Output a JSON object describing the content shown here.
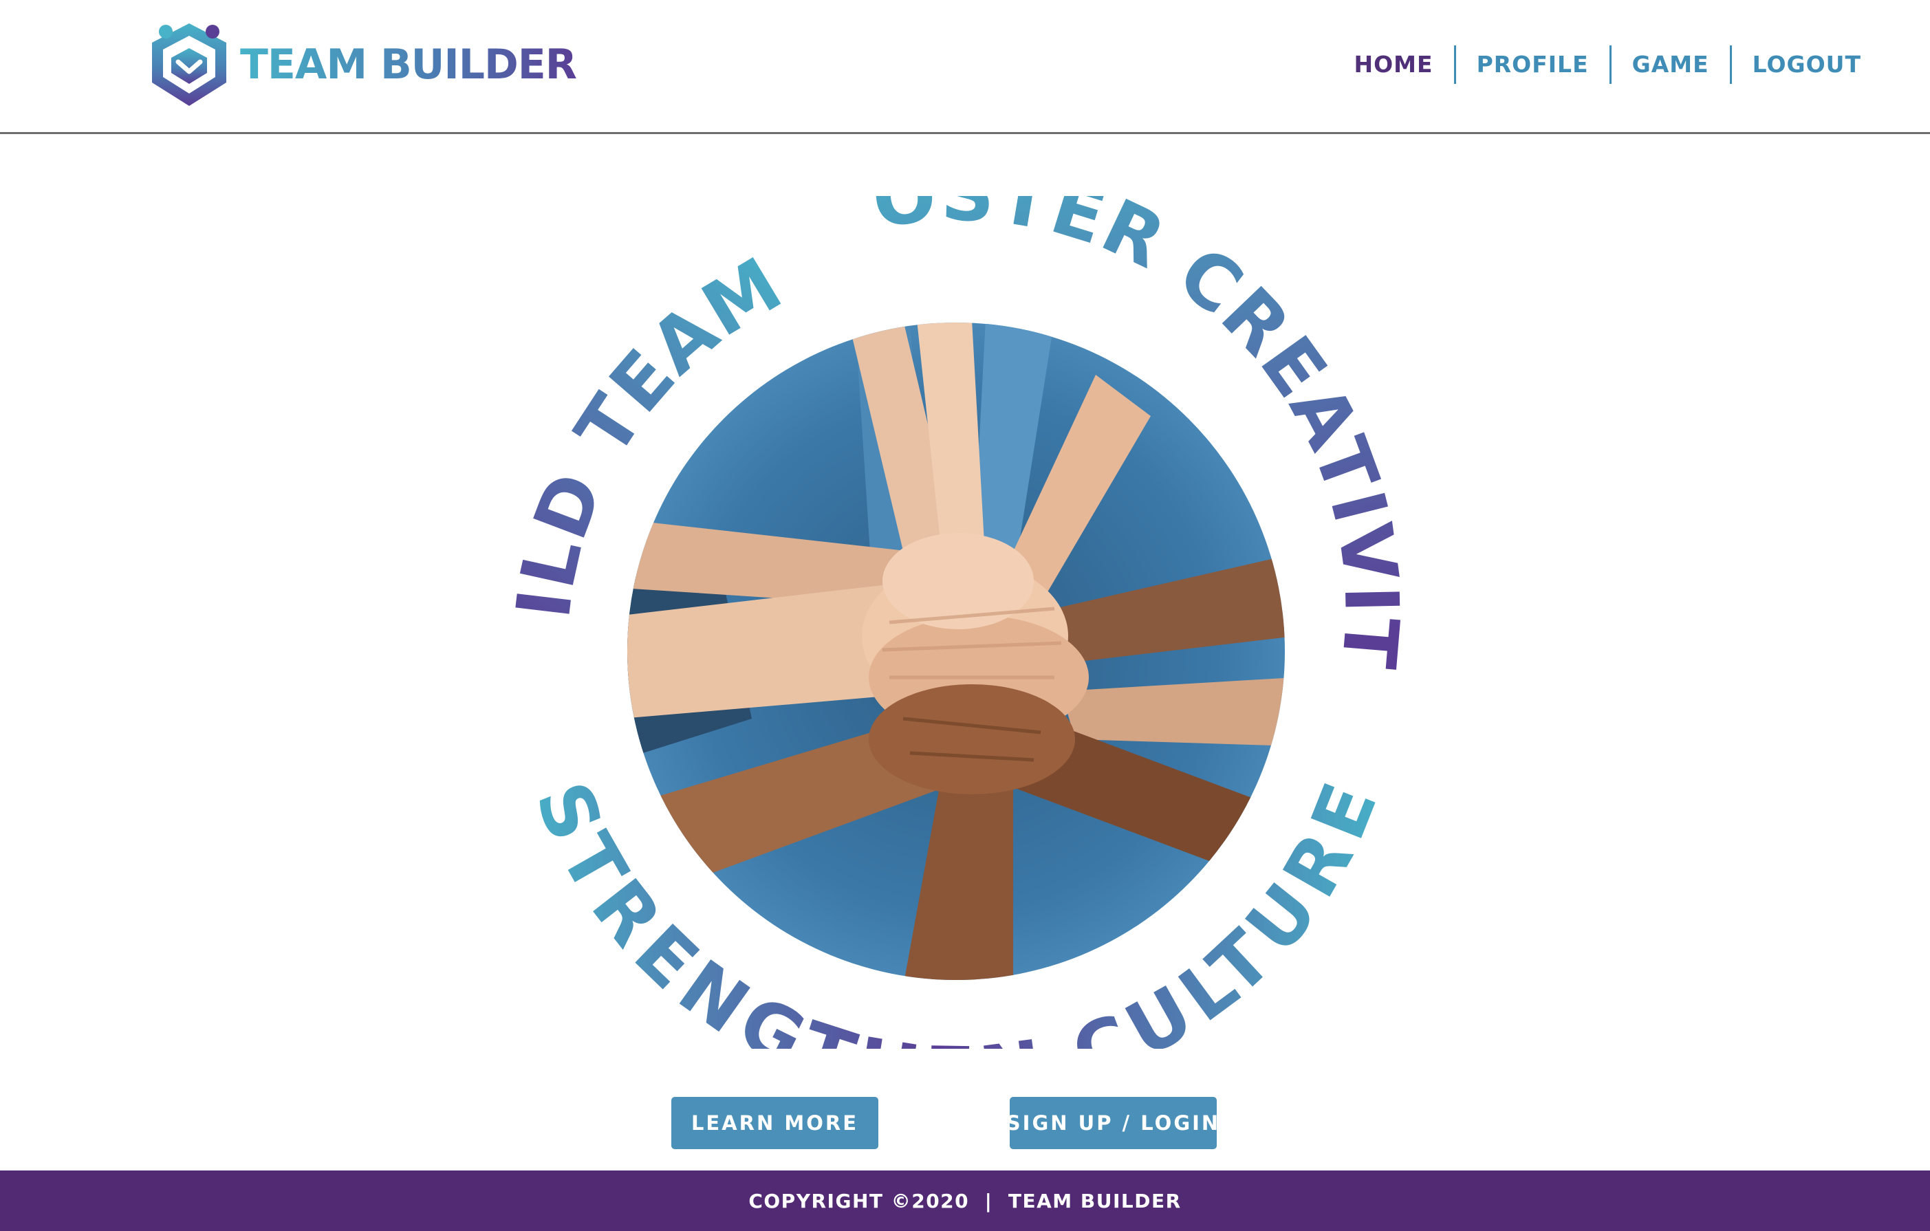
{
  "brand": {
    "name": "TEAM BUILDER",
    "logo_icon": "shield-people-logo",
    "colors": {
      "teal": "#47b2c8",
      "blue": "#4a90b8",
      "purple": "#512a73",
      "nav_active": "#51307a"
    }
  },
  "nav": {
    "items": [
      {
        "label": "HOME",
        "active": true
      },
      {
        "label": "PROFILE",
        "active": false
      },
      {
        "label": "GAME",
        "active": false
      },
      {
        "label": "LOGOUT",
        "active": false
      }
    ]
  },
  "hero": {
    "image": "stacked-hands-teamwork-photo",
    "phrases": {
      "left": "BUILD TEAMS",
      "right": "FOSTER CREATIVITY",
      "bottom": "STRENGTHEN CULTURE"
    }
  },
  "actions": {
    "learn_more": "LEARN MORE",
    "signup_login": "SIGN UP / LOGIN"
  },
  "footer": {
    "copyright": "COPYRIGHT ©2020",
    "separator": "|",
    "brand": "TEAM BUILDER"
  }
}
